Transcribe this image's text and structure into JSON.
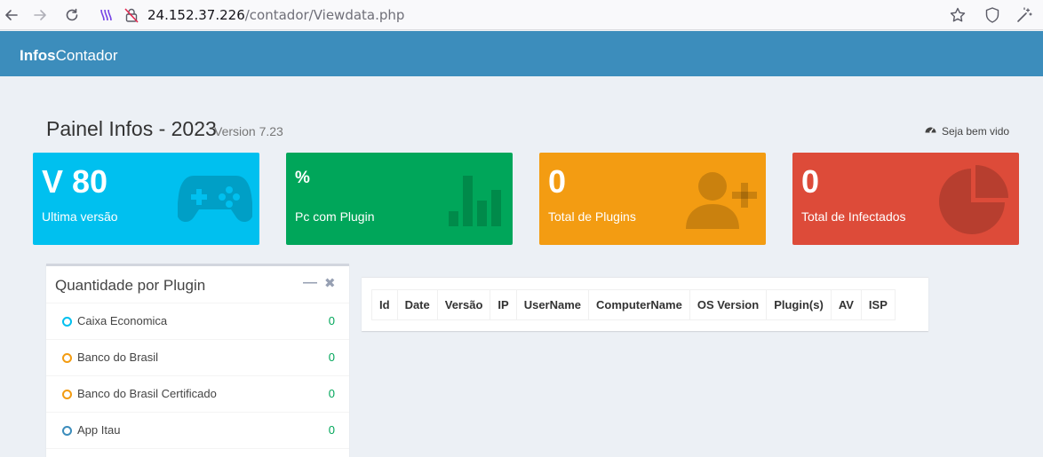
{
  "browser": {
    "url_host": "24.152.37.226",
    "url_path": "/contador/Viewdata.php"
  },
  "header": {
    "logo_bold": "Infos",
    "logo_rest": "Contador"
  },
  "page": {
    "title": "Painel Infos - 2023",
    "version": "Version 7.23",
    "welcome": "Seja bem vido"
  },
  "boxes": [
    {
      "value": "V 80",
      "label": "Ultima versão",
      "icon": "gamepad-icon",
      "color": "#00c0ef"
    },
    {
      "value": "%",
      "label": "Pc com Plugin",
      "icon": "bar-chart-icon",
      "color": "#00a65a"
    },
    {
      "value": "0",
      "label": "Total de Plugins",
      "icon": "user-plus-icon",
      "color": "#f39c12"
    },
    {
      "value": "0",
      "label": "Total de Infectados",
      "icon": "pie-chart-icon",
      "color": "#dd4b39"
    }
  ],
  "plugin_panel": {
    "title": "Quantidade por Plugin",
    "items": [
      {
        "name": "Caixa Economica",
        "count": "0",
        "dot_color": "#00c0ef"
      },
      {
        "name": "Banco do Brasil",
        "count": "0",
        "dot_color": "#f39c12"
      },
      {
        "name": "Banco do Brasil Certificado",
        "count": "0",
        "dot_color": "#f39c12"
      },
      {
        "name": "App Itau",
        "count": "0",
        "dot_color": "#3c8dbc"
      }
    ]
  },
  "table": {
    "columns": [
      "Id",
      "Date",
      "Versão",
      "IP",
      "UserName",
      "ComputerName",
      "OS Version",
      "Plugin(s)",
      "AV",
      "ISP"
    ]
  }
}
